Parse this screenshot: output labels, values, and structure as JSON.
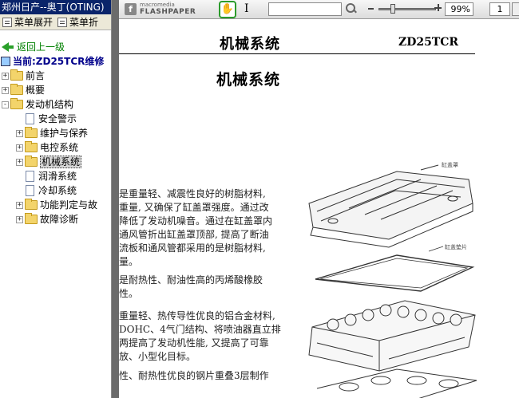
{
  "window": {
    "title": "郑州日产--奥丁(OTING)"
  },
  "left_toolbar": {
    "expand_label": "菜单展开",
    "collapse_label": "菜单折"
  },
  "tree": {
    "back_label": "返回上一级",
    "current_label": "当前:ZD25TCR维修",
    "items": [
      {
        "label": "前言",
        "type": "folder",
        "level": 0,
        "expander": "+"
      },
      {
        "label": "概要",
        "type": "folder",
        "level": 0,
        "expander": "+"
      },
      {
        "label": "发动机结构",
        "type": "folder",
        "level": 0,
        "expander": "-"
      },
      {
        "label": "安全警示",
        "type": "doc",
        "level": 1
      },
      {
        "label": "维护与保养",
        "type": "folder",
        "level": 1,
        "expander": "+"
      },
      {
        "label": "电控系统",
        "type": "folder",
        "level": 1,
        "expander": "+"
      },
      {
        "label": "机械系统",
        "type": "folder",
        "level": 1,
        "expander": "+",
        "selected": true
      },
      {
        "label": "润滑系统",
        "type": "doc",
        "level": 1
      },
      {
        "label": "冷却系统",
        "type": "doc",
        "level": 1
      },
      {
        "label": "功能判定与故",
        "type": "folder",
        "level": 1,
        "expander": "+"
      },
      {
        "label": "故障诊断",
        "type": "folder",
        "level": 1,
        "expander": "+"
      }
    ]
  },
  "viewer_toolbar": {
    "brand_line1": "macromedia",
    "brand_line2": "FLASHPAPER",
    "zoom_value": "99%",
    "page_value": "1"
  },
  "document": {
    "header_title": "机械系统",
    "header_code": "ZD25TCR",
    "section_title": "机械系统",
    "paragraphs": [
      [
        "是重量轻、减震性良好的树脂材料,",
        "重量, 又确保了缸盖罩强度。通过改",
        "降低了发动机噪音。通过在缸盖罩内",
        "通风管折出缸盖罩顶部, 提高了断油",
        "流板和通风管都采用的是树脂材料,",
        "量。"
      ],
      [
        "是耐热性、耐油性高的丙烯酸橡胶",
        "性。"
      ],
      [
        "重量轻、热传导性优良的铝合金材料,",
        "DOHC、4气门结构、将喷油器直立排",
        "两提高了发动机性能, 又提高了可靠",
        "放、小型化目标。"
      ],
      [
        "性、耐热性优良的钢片重叠3层制作"
      ]
    ],
    "figure_labels": [
      "缸盖罩",
      "缸盖垫片"
    ]
  }
}
